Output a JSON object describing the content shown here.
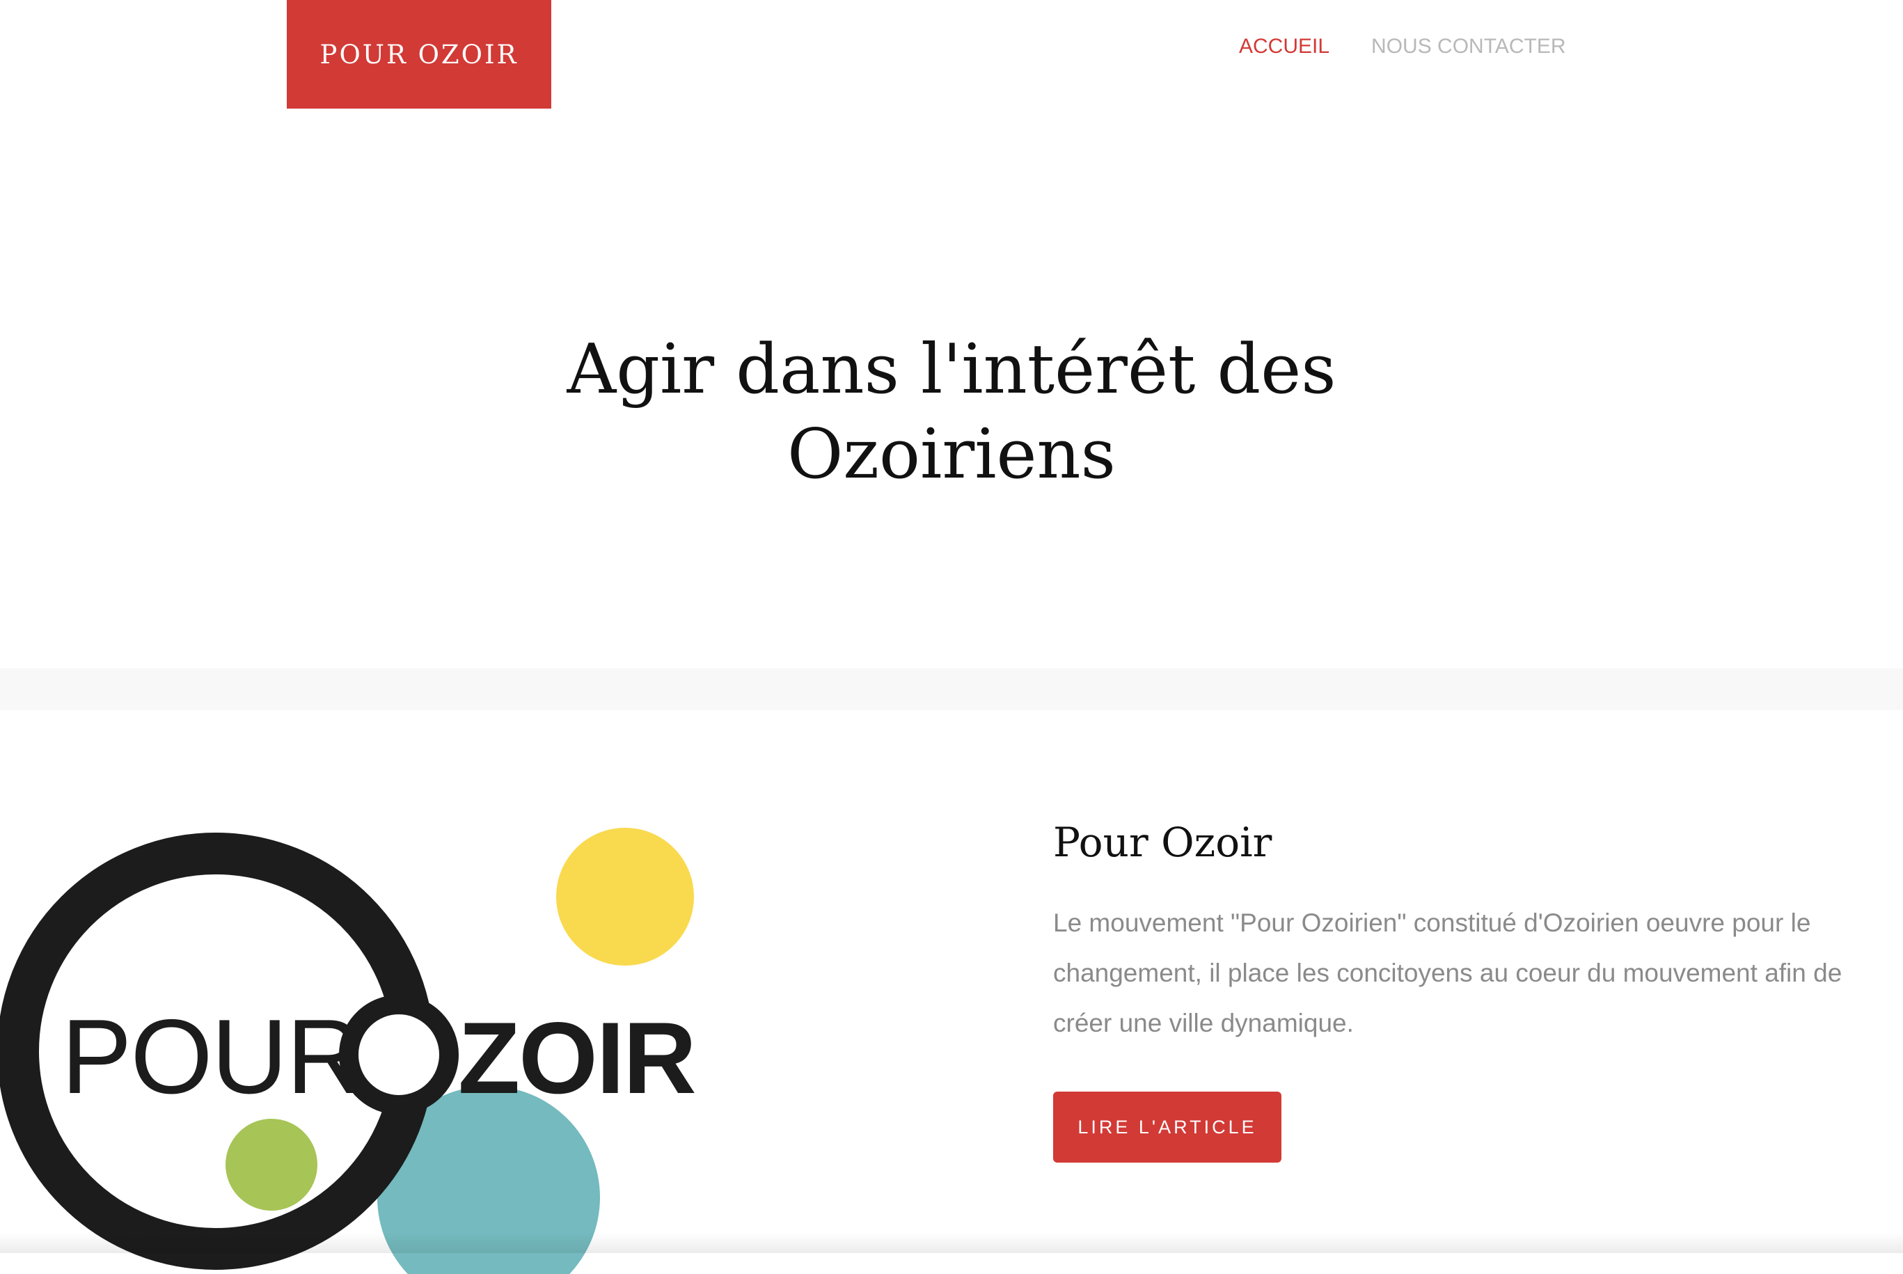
{
  "header": {
    "brand": "POUR OZOIR",
    "nav": [
      {
        "label": "ACCUEIL",
        "active": true
      },
      {
        "label": "NOUS CONTACTER",
        "active": false
      }
    ]
  },
  "hero": {
    "title_line1": "Agir dans l'intérêt des",
    "title_line2": "Ozoiriens"
  },
  "feature": {
    "logo_text_left": "POUR",
    "logo_text_right": "ZOIR",
    "title": "Pour Ozoir",
    "body": "Le mouvement \"Pour Ozoirien\" constitué d'Ozoirien oeuvre pour le changement, il place les concitoyens au coeur du mouvement afin de créer une ville dynamique.",
    "cta_label": "LIRE L'ARTICLE"
  },
  "colors": {
    "accent": "#d23a36",
    "logo_dark": "#1c1c1c",
    "logo_yellow": "#f9da4f",
    "logo_teal": "#74babe",
    "logo_green": "#a7c456",
    "nav_inactive": "#b8b8b8",
    "body_text": "#8a8a8a"
  }
}
